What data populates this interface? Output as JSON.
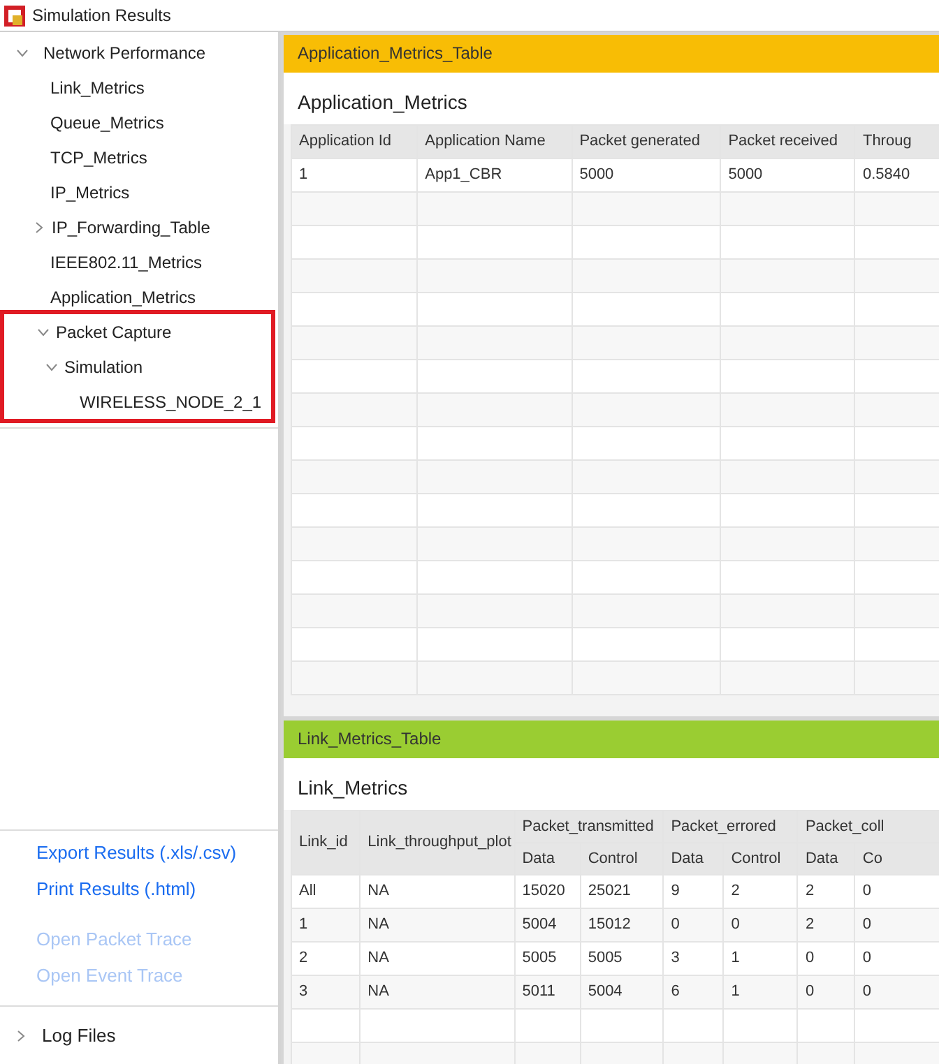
{
  "window": {
    "title": "Simulation Results"
  },
  "tree": [
    {
      "label": "Network Performance",
      "expanded": true,
      "children": [
        {
          "label": "Link_Metrics"
        },
        {
          "label": "Queue_Metrics"
        },
        {
          "label": "TCP_Metrics"
        },
        {
          "label": "IP_Metrics"
        },
        {
          "label": "IP_Forwarding_Table",
          "expanded": false
        },
        {
          "label": "IEEE802.11_Metrics"
        },
        {
          "label": "Application_Metrics"
        },
        {
          "label": "Packet Capture",
          "expanded": true,
          "highlighted": true,
          "children": [
            {
              "label": "Simulation",
              "expanded": true,
              "children": [
                {
                  "label": "WIRELESS_NODE_2_1"
                }
              ]
            }
          ]
        }
      ]
    }
  ],
  "actions": [
    {
      "label": "Export Results (.xls/.csv)",
      "disabled": false
    },
    {
      "label": "Print Results (.html)",
      "disabled": false
    },
    {
      "label": "Open Packet Trace",
      "disabled": true
    },
    {
      "label": "Open Event Trace",
      "disabled": true
    }
  ],
  "log_files": {
    "label": "Log Files",
    "expanded": false
  },
  "panels": [
    {
      "header": "Application_Metrics_Table",
      "color": "#f8bd05",
      "title": "Application_Metrics",
      "columns": [
        "Application Id",
        "Application Name",
        "Packet generated",
        "Packet received",
        "Throug"
      ],
      "rows": [
        [
          "1",
          "App1_CBR",
          "5000",
          "5000",
          "0.5840"
        ]
      ]
    },
    {
      "header": "Link_Metrics_Table",
      "color": "#9acd32",
      "title": "Link_Metrics",
      "columns": [
        "Link_id",
        "Link_throughput_plot"
      ],
      "groups": [
        {
          "label": "Packet_transmitted",
          "sub": [
            "Data",
            "Control"
          ]
        },
        {
          "label": "Packet_errored",
          "sub": [
            "Data",
            "Control"
          ]
        },
        {
          "label": "Packet_coll",
          "sub": [
            "Data",
            "Co"
          ]
        }
      ],
      "rows": [
        [
          "All",
          "NA",
          "15020",
          "25021",
          "9",
          "2",
          "2",
          "0"
        ],
        [
          "1",
          "NA",
          "5004",
          "15012",
          "0",
          "0",
          "2",
          "0"
        ],
        [
          "2",
          "NA",
          "5005",
          "5005",
          "3",
          "1",
          "0",
          "0"
        ],
        [
          "3",
          "NA",
          "5011",
          "5004",
          "6",
          "1",
          "0",
          "0"
        ]
      ]
    }
  ]
}
